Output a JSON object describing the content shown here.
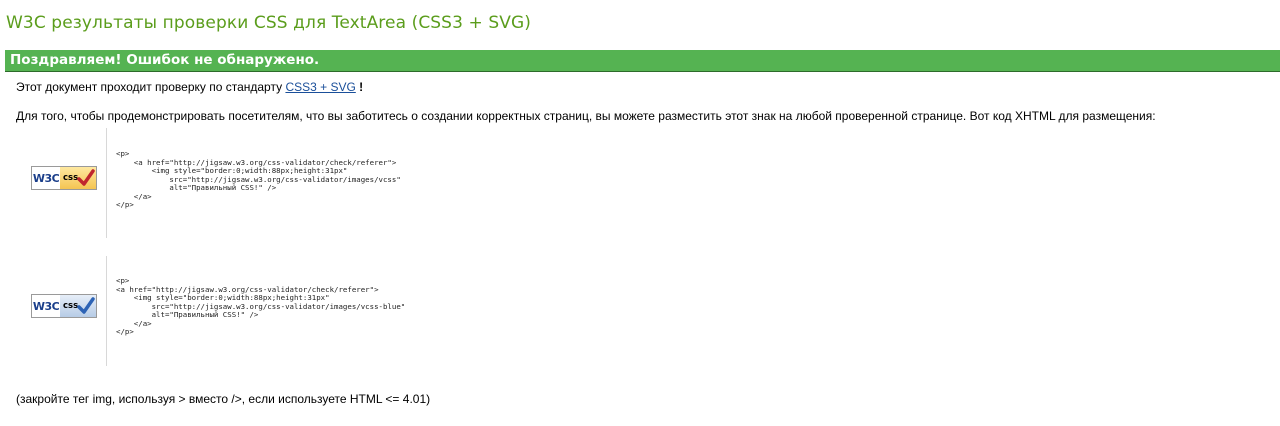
{
  "title": "W3C результаты проверки CSS для TextArea (CSS3 + SVG)",
  "congrats": "Поздравляем! Ошибок не обнаружено.",
  "intro": {
    "prefix": "Этот документ проходит проверку по стандарту",
    "link": "CSS3 + SVG",
    "suffix": "!"
  },
  "description": "Для того, чтобы продемонстрировать посетителям, что вы заботитесь о создании корректных страниц, вы можете разместить этот знак на любой проверенной странице. Вот код XHTML для размещения:",
  "badges": [
    {
      "w3c_text": "W3C",
      "css_text": "css",
      "variant": "gold",
      "check_color": "#c0262e",
      "code": "<p>\n    <a href=\"http://jigsaw.w3.org/css-validator/check/referer\">\n        <img style=\"border:0;width:88px;height:31px\"\n            src=\"http://jigsaw.w3.org/css-validator/images/vcss\"\n            alt=\"Правильный CSS!\" />\n    </a>\n</p>"
    },
    {
      "w3c_text": "W3C",
      "css_text": "css",
      "variant": "blue",
      "check_color": "#2d63b5",
      "code": "<p>\n<a href=\"http://jigsaw.w3.org/css-validator/check/referer\">\n    <img style=\"border:0;width:88px;height:31px\"\n        src=\"http://jigsaw.w3.org/css-validator/images/vcss-blue\"\n        alt=\"Правильный CSS!\" />\n    </a>\n</p>"
    }
  ],
  "note": "(закройте тег img, используя > вместо />, если используете HTML <= 4.01)"
}
